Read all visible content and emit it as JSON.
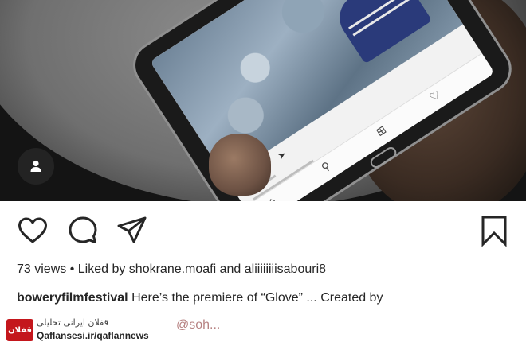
{
  "post": {
    "views_count": "73 views",
    "likes_text": "• Liked by shokrane.moafi and aliiiiiiiisabouri8",
    "caption_username": "boweryfilmfestival",
    "caption_text": "Here’s the premiere of “Glove” ... Created by",
    "more_text_fragment": "@soh..."
  },
  "watermark": {
    "site_line": "قفلان ایرانی تحلیلی",
    "handle": "Qaflansesi.ir/qaflannews",
    "logo_text": "قفلان"
  },
  "icons": {
    "user_tag": "user-tag-icon",
    "like": "heart-icon",
    "comment": "comment-icon",
    "share": "paper-plane-icon",
    "save": "bookmark-icon"
  },
  "colors": {
    "text": "#262626",
    "icon_stroke": "#262626",
    "watermark_red": "#c4161c"
  }
}
